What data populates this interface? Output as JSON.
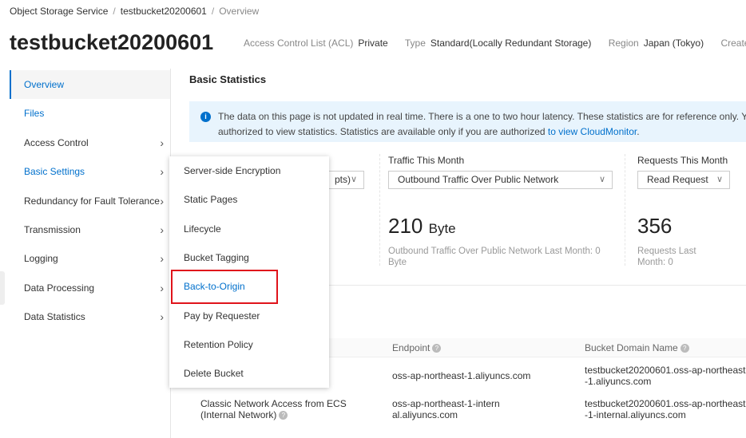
{
  "breadcrumb": [
    "Object Storage Service",
    "testbucket20200601",
    "Overview"
  ],
  "bucket": {
    "name": "testbucket20200601",
    "meta": [
      {
        "k": "Access Control List (ACL)",
        "v": "Private"
      },
      {
        "k": "Type",
        "v": "Standard(Locally Redundant Storage)"
      },
      {
        "k": "Region",
        "v": "Japan (Tokyo)"
      },
      {
        "k": "Created",
        "v": ""
      }
    ]
  },
  "sidebar": {
    "items": [
      {
        "label": "Overview",
        "active": true
      },
      {
        "label": "Files"
      },
      {
        "label": "Access Control",
        "chevron": true
      },
      {
        "label": "Basic Settings",
        "chevron": true
      },
      {
        "label": "Redundancy for Fault Tolerance",
        "chevron": true
      },
      {
        "label": "Transmission",
        "chevron": true
      },
      {
        "label": "Logging",
        "chevron": true
      },
      {
        "label": "Data Processing",
        "chevron": true
      },
      {
        "label": "Data Statistics",
        "chevron": true
      }
    ]
  },
  "main": {
    "section_title": "Basic Statistics",
    "info": {
      "text1": "The data on this page is not updated in real time. There is a one to two hour latency. These statistics are for reference only. Yo",
      "text2": "authorized to view statistics. Statistics are available only if you are authorized ",
      "link": "to view CloudMonitor",
      "tail": "."
    },
    "stats": [
      {
        "select": "pts)"
      },
      {
        "label": "Traffic This Month",
        "select": "Outbound Traffic Over Public Network",
        "value": "210",
        "unit": "Byte",
        "sub": "Outbound Traffic Over Public Network Last Month: 0 Byte"
      },
      {
        "label": "Requests This Month",
        "select": "Read Request",
        "value": "356",
        "sub": "Requests Last Month: 0"
      }
    ],
    "table": {
      "headers": [
        "Endpoint",
        "Bucket Domain Name"
      ],
      "rows": [
        {
          "access": "",
          "endpoint": "oss-ap-northeast-1.aliyuncs.com",
          "domain": "testbucket20200601.oss-ap-northeast-1.aliyuncs.com"
        },
        {
          "access": "Classic Network Access from ECS (Internal Network)",
          "endpoint": "oss-ap-northeast-1-internal.aliyuncs.com",
          "domain": "testbucket20200601.oss-ap-northeast-1-internal.aliyuncs.com"
        }
      ]
    }
  },
  "menu": {
    "items": [
      "Server-side Encryption",
      "Static Pages",
      "Lifecycle",
      "Bucket Tagging",
      "Back-to-Origin",
      "Pay by Requester",
      "Retention Policy",
      "Delete Bucket"
    ],
    "highlighted": "Back-to-Origin"
  },
  "colors": {
    "accent": "#0070cc",
    "highlight_box": "#e0131b",
    "info_bg": "#e8f4fd"
  }
}
